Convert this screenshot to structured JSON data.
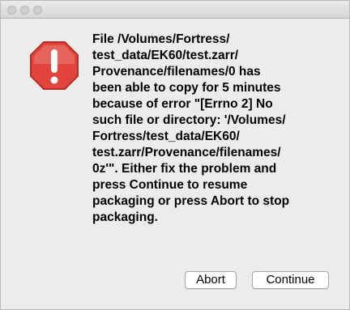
{
  "dialog": {
    "message": "File /Volumes/Fortress/\ntest_data/EK60/test.zarr/\nProvenance/filenames/0 has\nbeen able to copy for 5 minutes\nbecause of error \"[Errno 2] No\nsuch file or directory: '/Volumes/\nFortress/test_data/EK60/\ntest.zarr/Provenance/filenames/\n0z'\". Either fix the problem and\npress Continue to resume\npackaging or press Abort to stop\npackaging.",
    "icon": "alert-icon",
    "abort_label": "Abort",
    "continue_label": "Continue"
  },
  "colors": {
    "icon_fill": "#e0443a",
    "icon_stroke": "#b52f27",
    "window_bg": "#ececec"
  }
}
